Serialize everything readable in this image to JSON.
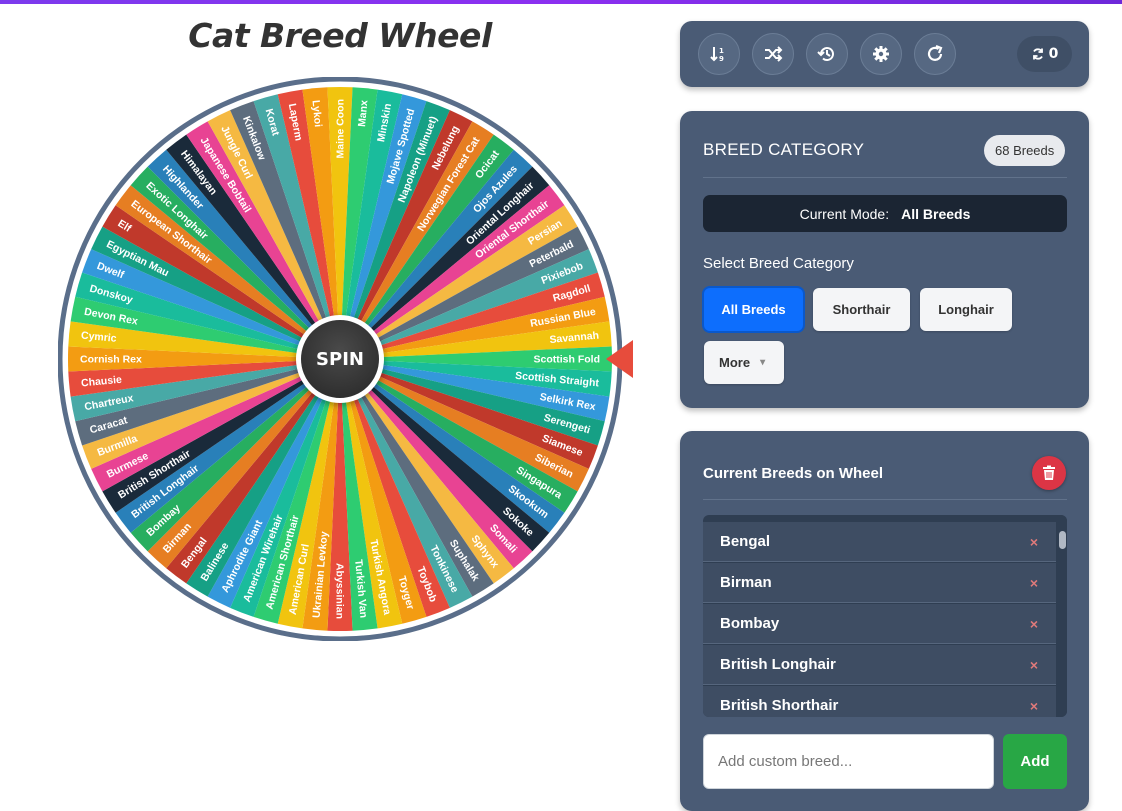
{
  "app": {
    "title": "Cat Breed Wheel"
  },
  "wheel": {
    "spin_label": "SPIN",
    "colors": [
      "#e74c3c",
      "#f39c12",
      "#f1c40f",
      "#2ecc71",
      "#1abc9c",
      "#3498db",
      "#16a085",
      "#c0392b",
      "#e67e22",
      "#27ae60",
      "#2980b9",
      "#1a2a3a",
      "#e84393",
      "#f5b942",
      "#5d6d7e",
      "#48a9a6"
    ],
    "segments": [
      "Abyssinian",
      "Ukrainian Levkoy",
      "American Curl",
      "American Shorthair",
      "American Wirehair",
      "Aphrodite Giant",
      "Balinese",
      "Bengal",
      "Birman",
      "Bombay",
      "British Longhair",
      "British Shorthair",
      "Burmese",
      "Burmilla",
      "Caracat",
      "Chartreux",
      "Chausie",
      "Cornish Rex",
      "Cymric",
      "Devon Rex",
      "Donskoy",
      "Dwelf",
      "Egyptian Mau",
      "Elf",
      "European Shorthair",
      "Exotic Longhair",
      "Highlander",
      "Himalayan",
      "Japanese Bobtail",
      "Jungle Curl",
      "Kinkalow",
      "Korat",
      "Laperm",
      "Lykoi",
      "Maine Coon",
      "Manx",
      "Minskin",
      "Mojave Spotted",
      "Napoleon (Minuet)",
      "Nebelung",
      "Norwegian Forest Cat",
      "Ocicat",
      "Ojos Azules",
      "Oriental Longhair",
      "Oriental Shorthair",
      "Persian",
      "Peterbald",
      "Pixiebob",
      "Ragdoll",
      "Russian Blue",
      "Savannah",
      "Scottish Fold",
      "Scottish Straight",
      "Selkirk Rex",
      "Serengeti",
      "Siamese",
      "Siberian",
      "Singapura",
      "Skookum",
      "Sokoke",
      "Somali",
      "Sphynx",
      "Suphalak",
      "Tonkinese",
      "Toybob",
      "Toyger",
      "Turkish Angora",
      "Turkish Van"
    ]
  },
  "toolbar": {
    "icons": [
      "sort-icon",
      "shuffle-icon",
      "history-icon",
      "settings-icon",
      "reset-icon"
    ],
    "spin_count": "0"
  },
  "category_panel": {
    "heading": "BREED CATEGORY",
    "breed_count": "68 Breeds",
    "mode_label": "Current Mode:",
    "mode_value": "All Breeds",
    "select_label": "Select Breed Category",
    "buttons": [
      "All Breeds",
      "Shorthair",
      "Longhair",
      "More"
    ],
    "more_caret": "▾",
    "active": "All Breeds"
  },
  "breeds_panel": {
    "heading": "Current Breeds on Wheel",
    "visible_rows": [
      "Bengal",
      "Birman",
      "Bombay",
      "British Longhair",
      "British Shorthair"
    ],
    "remove_symbol": "×",
    "input_placeholder": "Add custom breed...",
    "add_label": "Add"
  },
  "accent_colors": {
    "primary": "#0d6efd",
    "danger": "#dc3545",
    "success": "#28a745",
    "panel": "#4a5b75",
    "pointer": "#e74c3c"
  }
}
